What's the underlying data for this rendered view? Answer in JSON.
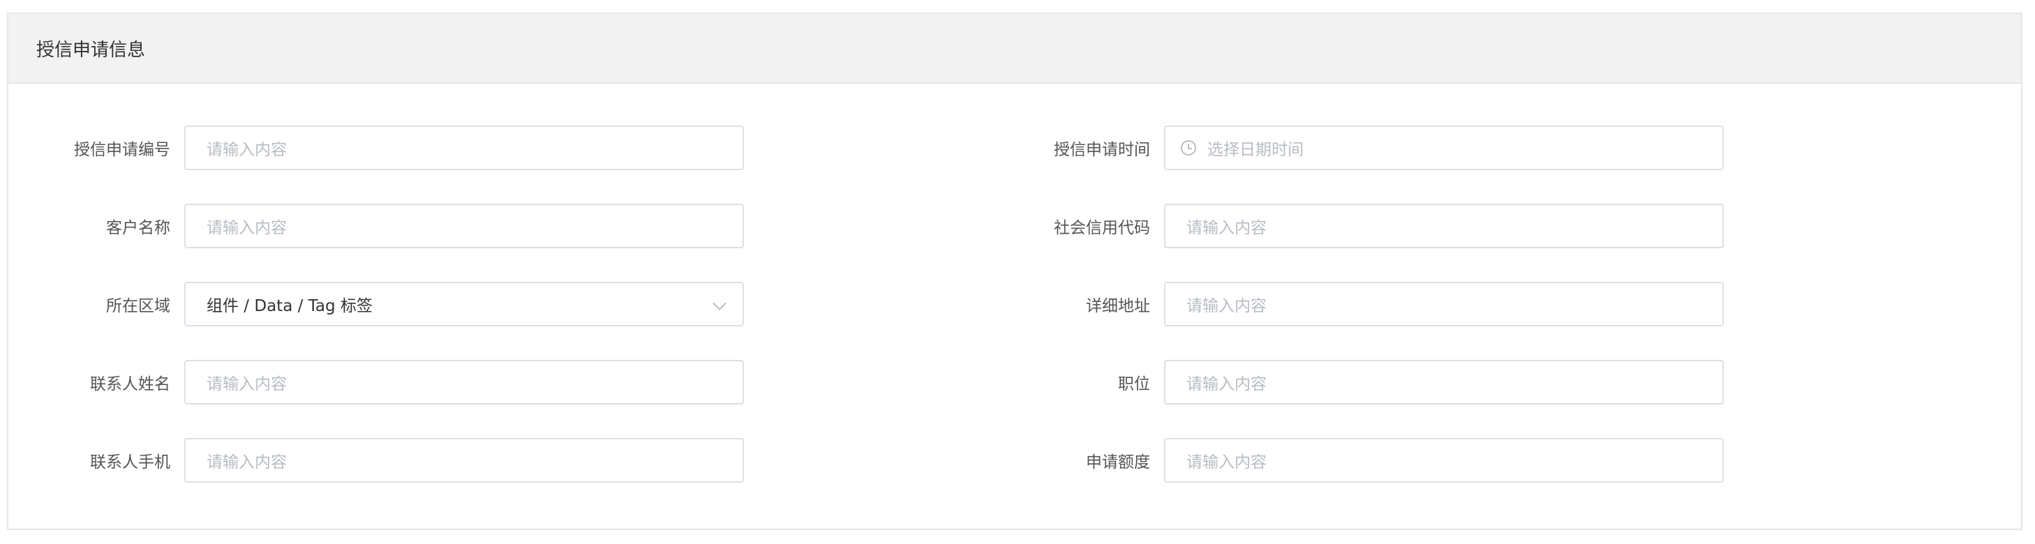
{
  "card": {
    "title": "授信申请信息"
  },
  "form": {
    "left": [
      {
        "label": "授信申请编号",
        "placeholder": "请输入内容",
        "value": ""
      },
      {
        "label": "客户名称",
        "placeholder": "请输入内容",
        "value": ""
      },
      {
        "label": "所在区域",
        "placeholder": "",
        "value": "组件 / Data / Tag 标签",
        "type": "select"
      },
      {
        "label": "联系人姓名",
        "placeholder": "请输入内容",
        "value": ""
      },
      {
        "label": "联系人手机",
        "placeholder": "请输入内容",
        "value": ""
      }
    ],
    "right": [
      {
        "label": "授信申请时间",
        "placeholder": "选择日期时间",
        "value": "",
        "type": "datetime",
        "icon": "clock-icon"
      },
      {
        "label": "社会信用代码",
        "placeholder": "请输入内容",
        "value": ""
      },
      {
        "label": "详细地址",
        "placeholder": "请输入内容",
        "value": ""
      },
      {
        "label": "职位",
        "placeholder": "请输入内容",
        "value": ""
      },
      {
        "label": "申请额度",
        "placeholder": "请输入内容",
        "value": ""
      }
    ]
  },
  "colors": {
    "header_bg": "#f2f2f2",
    "border": "#dcdfe6",
    "placeholder": "#b8bcc4",
    "text": "#333333"
  }
}
